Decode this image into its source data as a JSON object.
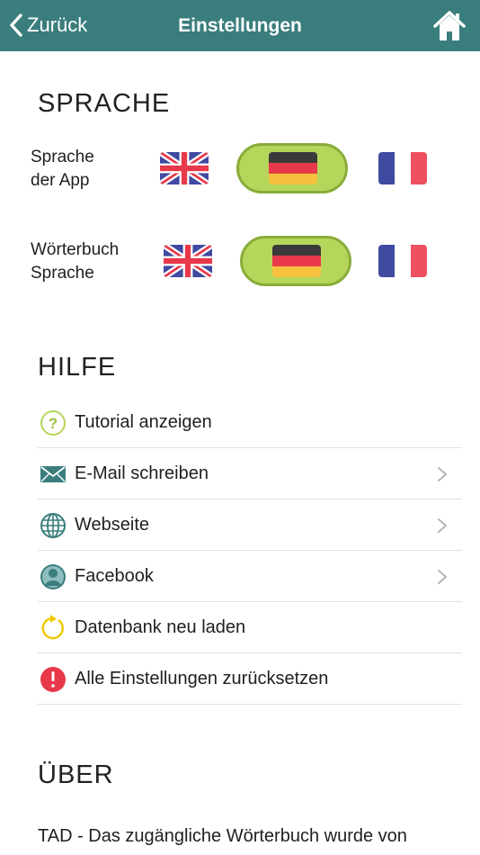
{
  "navbar": {
    "back_label": "Zurück",
    "title": "Einstellungen",
    "color": "#3a7d7d"
  },
  "sprache": {
    "title": "SPRACHE",
    "rows": [
      {
        "line1": "Sprache",
        "line2": "der App",
        "flags": [
          "uk-flag-icon",
          "germany-flag-icon",
          "france-flag-icon"
        ],
        "selected": "germany-flag-icon"
      },
      {
        "line1": "Wörterbuch",
        "line2": "Sprache",
        "flags": [
          "uk-flag-icon",
          "germany-flag-icon",
          "france-flag-icon"
        ],
        "selected": "germany-flag-icon"
      }
    ],
    "selected_color": "#b5d65a"
  },
  "hilfe": {
    "title": "HILFE",
    "items": [
      {
        "label": "Tutorial anzeigen",
        "icon": "question-circle-icon",
        "chevron": false
      },
      {
        "label": "E-Mail schreiben",
        "icon": "envelope-icon",
        "chevron": true
      },
      {
        "label": "Webseite",
        "icon": "globe-icon",
        "chevron": true
      },
      {
        "label": "Facebook",
        "icon": "person-circle-icon",
        "chevron": true
      },
      {
        "label": "Datenbank neu laden",
        "icon": "reload-icon",
        "chevron": false
      },
      {
        "label": "Alle Einstellungen zurücksetzen",
        "icon": "exclamation-circle-icon",
        "chevron": false
      }
    ]
  },
  "ueber": {
    "title": "ÜBER",
    "text": "TAD - Das zugängliche Wörterbuch wurde von"
  }
}
